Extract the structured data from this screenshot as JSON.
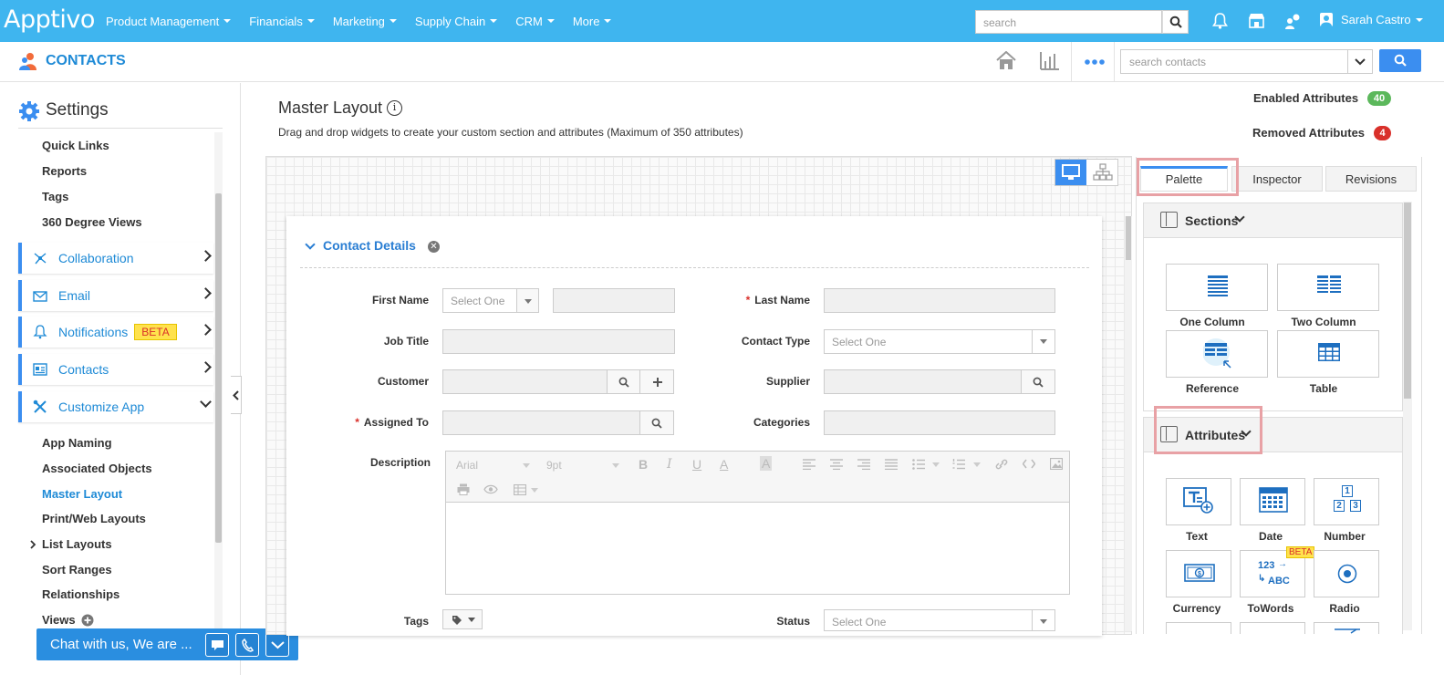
{
  "topbar": {
    "logo": "Apptivo",
    "nav": [
      "Product Management",
      "Financials",
      "Marketing",
      "Supply Chain",
      "CRM",
      "More"
    ],
    "search_placeholder": "search",
    "user_name": "Sarah Castro"
  },
  "appbar": {
    "title": "CONTACTS",
    "search_placeholder": "search contacts"
  },
  "sidebar": {
    "title": "Settings",
    "top_links": [
      "Quick Links",
      "Reports",
      "Tags",
      "360 Degree Views"
    ],
    "groups": [
      {
        "label": "Collaboration",
        "icon": "collaboration-icon"
      },
      {
        "label": "Email",
        "icon": "email-icon"
      },
      {
        "label": "Notifications",
        "icon": "bell-icon",
        "badge": "BETA"
      },
      {
        "label": "Contacts",
        "icon": "contacts-icon"
      },
      {
        "label": "Customize App",
        "icon": "tools-icon"
      }
    ],
    "sub_links": [
      "App Naming",
      "Associated Objects",
      "Master Layout",
      "Print/Web Layouts",
      "List Layouts",
      "Sort Ranges",
      "Relationships",
      "Views"
    ],
    "active_link": "Master Layout"
  },
  "chat": {
    "label": "Chat with us, We are ..."
  },
  "main": {
    "title": "Master Layout",
    "subtitle": "Drag and drop widgets to create your custom section and attributes (Maximum of 350 attributes)",
    "enabled_label": "Enabled Attributes",
    "enabled_count": "40",
    "removed_label": "Removed Attributes",
    "removed_count": "4"
  },
  "form": {
    "section_title": "Contact Details",
    "first_name_label": "First Name",
    "first_name_select": "Select One",
    "last_name_label": "Last Name",
    "job_title_label": "Job Title",
    "contact_type_label": "Contact Type",
    "contact_type_select": "Select One",
    "customer_label": "Customer",
    "supplier_label": "Supplier",
    "assigned_to_label": "Assigned To",
    "categories_label": "Categories",
    "description_label": "Description",
    "editor_font": "Arial",
    "editor_size": "9pt",
    "tags_label": "Tags",
    "status_label": "Status",
    "status_select": "Select One"
  },
  "palette": {
    "tabs": [
      "Palette",
      "Inspector",
      "Revisions"
    ],
    "sections_header": "Sections",
    "sections": [
      "One Column",
      "Two Column",
      "Reference",
      "Table"
    ],
    "attributes_header": "Attributes",
    "attributes": [
      "Text",
      "Date",
      "Number",
      "Currency",
      "ToWords",
      "Radio"
    ],
    "beta_badge": "BETA",
    "number_glyphs": [
      "1",
      "2",
      "3"
    ],
    "towords_glyphs": [
      "123",
      "ABC"
    ]
  },
  "colors": {
    "topbar": "#3fb5ef",
    "accent": "#3b8ef0",
    "link": "#1e8ad6",
    "enabled": "#5cb85c",
    "removed": "#d9302a",
    "highlight": "#e8a1a5"
  }
}
